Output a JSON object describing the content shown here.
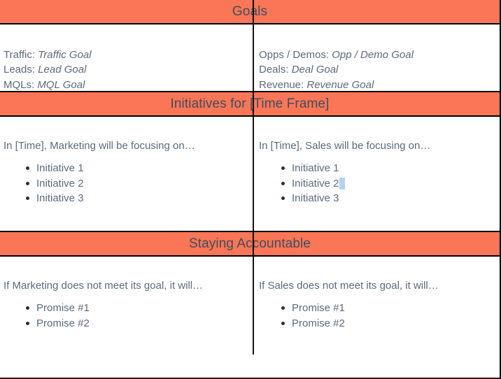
{
  "colors": {
    "band_background": "#fb7656",
    "band_title_text": "#3f4c5e",
    "body_text": "#5b6b7d",
    "bullet": "#243047",
    "selection_highlight": "#b6d2f2",
    "rule": "#000000"
  },
  "sections": [
    {
      "title": "Goals",
      "left": {
        "goal_lines": [
          {
            "label": "Traffic:",
            "value": "Traffic Goal"
          },
          {
            "label": "Leads:",
            "value": "Lead Goal"
          },
          {
            "label": "MQLs:",
            "value": "MQL Goal"
          }
        ]
      },
      "right": {
        "goal_lines": [
          {
            "label": "Opps / Demos:",
            "value": "Opp / Demo Goal"
          },
          {
            "label": "Deals:",
            "value": "Deal Goal"
          },
          {
            "label": "Revenue:",
            "value": "Revenue Goal"
          }
        ]
      }
    },
    {
      "title": "Initiatives for [Time Frame]",
      "left": {
        "lead_in": "In [Time], Marketing will be focusing on…",
        "items": [
          "Initiative 1",
          "Initiative 2",
          "Initiative 3"
        ]
      },
      "right": {
        "lead_in": "In [Time], Sales will be focusing on…",
        "items": [
          "Initiative 1",
          "Initiative 2",
          "Initiative 3"
        ],
        "selected_item_index": 1
      }
    },
    {
      "title": "Staying Accountable",
      "left": {
        "lead_in": "If Marketing does not meet its goal, it will…",
        "items": [
          "Promise #1",
          "Promise #2"
        ]
      },
      "right": {
        "lead_in": "If Sales does not meet its goal, it will…",
        "items": [
          "Promise #1",
          "Promise #2"
        ]
      }
    }
  ]
}
